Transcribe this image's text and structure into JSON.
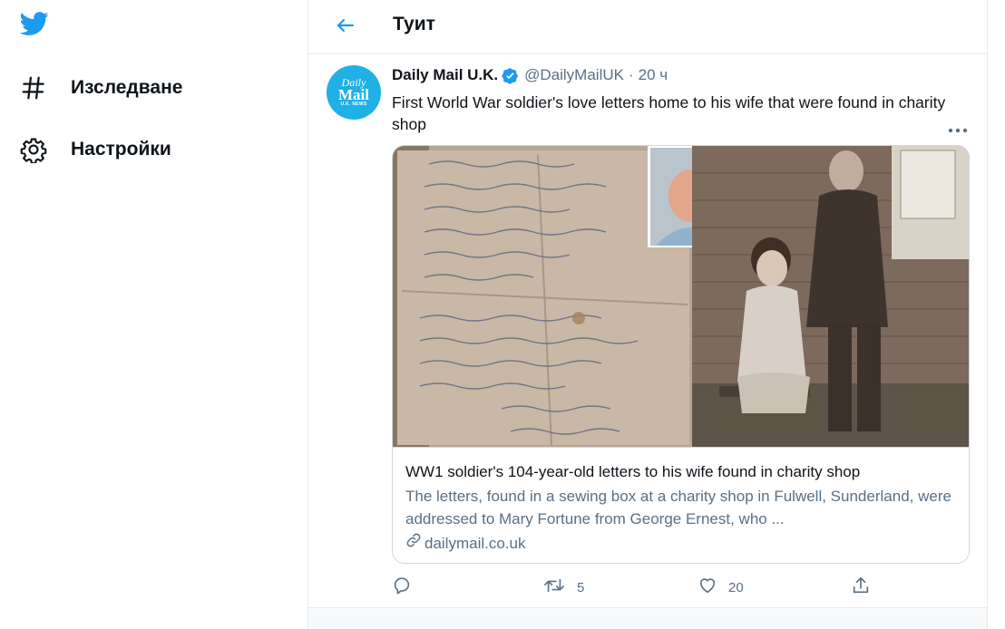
{
  "sidebar": {
    "logo_icon": "twitter-bird-icon",
    "items": [
      {
        "label": "Изследване",
        "icon": "hashtag-icon"
      },
      {
        "label": "Настройки",
        "icon": "gear-icon"
      }
    ]
  },
  "header": {
    "back_icon": "arrow-left-icon",
    "title": "Туит"
  },
  "tweet": {
    "avatar": {
      "line1": "Daily",
      "line2": "Mail",
      "line3": "U.K. NEWS"
    },
    "author_name": "Daily Mail U.K.",
    "verified_icon": "verified-badge-icon",
    "handle": "@DailyMailUK",
    "separator": "·",
    "time": "20 ч",
    "text": "First World War soldier's love letters home to his wife that were found in charity shop",
    "card": {
      "title": "WW1 soldier's 104-year-old letters to his wife found in charity shop",
      "description": "The letters, found in a sewing box at a charity shop in Fulwell, Sunderland, were addressed to Mary Fortune from George Ernest, who ...",
      "domain": "dailymail.co.uk"
    },
    "actions": {
      "reply_count": "",
      "retweet_count": "5",
      "like_count": "20"
    }
  },
  "colors": {
    "brand_blue": "#1d9bf0",
    "secondary_text": "#5b7083",
    "border": "#e6ecf0"
  }
}
